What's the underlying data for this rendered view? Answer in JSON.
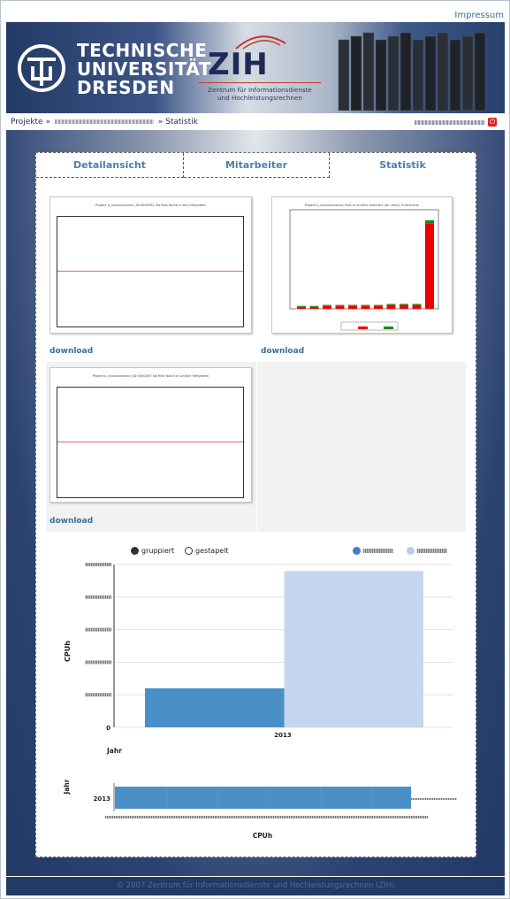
{
  "header": {
    "impressum": "Impressum",
    "tud_lines": [
      "TECHNISCHE",
      "UNIVERSITÄT",
      "DRESDEN"
    ],
    "zih_title": "ZIH",
    "zih_sub_1": "Zentrum für Informationsdienste",
    "zih_sub_2": "und Hochleistungsrechnen"
  },
  "breadcrumb": {
    "root": "Projekte",
    "sep": "»",
    "current": "Statistik"
  },
  "tabs": [
    "Detailansicht",
    "Mitarbeiter",
    "Statistik"
  ],
  "plots": {
    "p1_title": "Project p_xxxxxxxxxxxx (ID:000026): No files found in this filesystem",
    "p2_title": "Project p_xxxxxxxxxxxx: files in scratch directory (all users) in directory",
    "p3_title": "Project p_xxxxxxxxxxxx (ID:000026): No files found in scratch filesystem",
    "download": "download"
  },
  "chart_controls": {
    "grouped": "gruppiert",
    "stacked": "gestapelt"
  },
  "chart_data": {
    "type": "bar",
    "categories": [
      "2013"
    ],
    "series": [
      {
        "values": [
          1200
        ]
      },
      {
        "values": [
          4800
        ]
      }
    ],
    "xlabel": "Jahr",
    "ylabel": "CPUh",
    "ylim": [
      0,
      5000
    ],
    "y_tick_label": "0",
    "colors": [
      "#4a90c6",
      "#c5d6ee"
    ],
    "mini": {
      "ylabel": "Jahr",
      "xlabel": "CPUh",
      "category": "2013",
      "color": "#4a90c6"
    }
  },
  "footer": "© 2007 Zentrum für Informationsdienste und Hochleistungsrechnen (ZIH)"
}
